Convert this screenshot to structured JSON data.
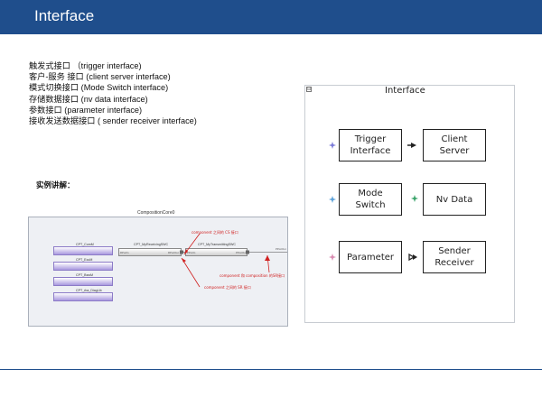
{
  "slide": {
    "title": "Interface",
    "bullets": [
      "触发式接口 （trigger interface)",
      "客户-服务 接口 (client server interface)",
      "模式切换接口 (Mode Switch interface)",
      "存储数据接口 (nv data interface)",
      "参数接口 (parameter interface)",
      "接收发送数据接口 ( sender receiver interface)"
    ],
    "example_label": "实例讲解："
  },
  "composition": {
    "title": "CompositionCore0",
    "swcs": [
      "CPT_ComM",
      "CPT_EcuM",
      "CPT_BswM",
      "CPT_rba_DiagLib"
    ],
    "receiving_swc": "CPT_MyReceivingSWC",
    "transmitting_swc": "CPT_MyTransmittingSWC",
    "ports": {
      "left": "RPortIn",
      "mid_left": "RPortOut",
      "mid_right": "PPortIn",
      "right": "PPortOut",
      "external": "PPortOut"
    },
    "annotations": {
      "cs": "component 之间的 CS 接口",
      "sr": "component 之间的 SR 接口",
      "external": "component 和 composition 的SR接口"
    }
  },
  "interface_panel": {
    "title": "Interface",
    "collapse_symbol": "⊟",
    "boxes": {
      "trigger": "Trigger\nInterface",
      "client_server": "Client\nServer",
      "mode_switch": "Mode\nSwitch",
      "nv_data": "Nv Data",
      "parameter": "Parameter",
      "sender_receiver": "Sender\nReceiver"
    },
    "colors": {
      "trigger_icon": "#7a7ad8",
      "mode_icon": "#5aa0d8",
      "nv_icon": "#3aa36a",
      "parameter_icon": "#d88ab0"
    }
  }
}
